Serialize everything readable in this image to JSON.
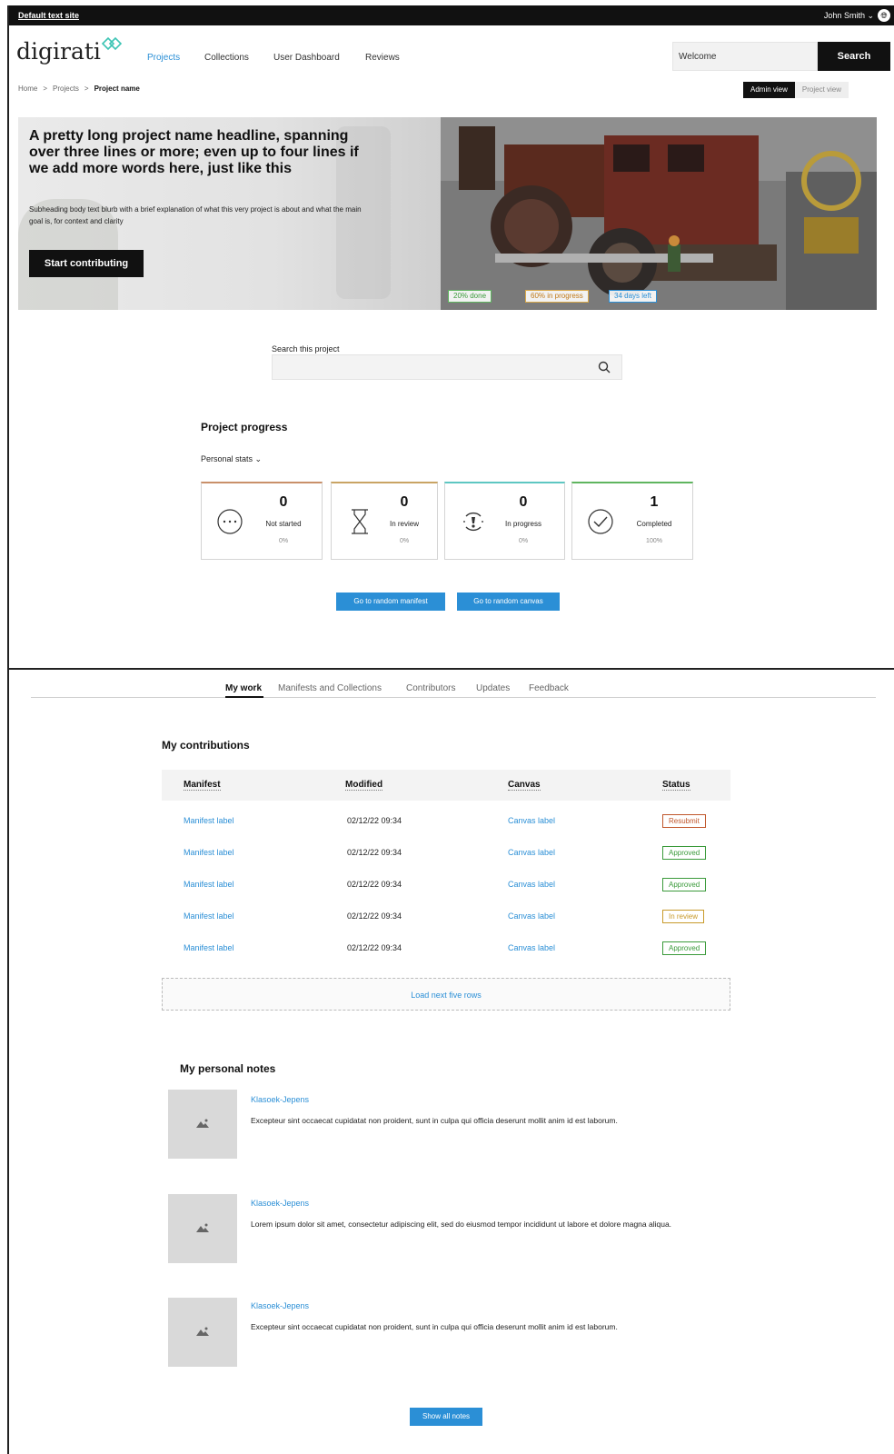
{
  "topbar": {
    "site_link": "Default text site",
    "user": "John Smith  ⌄"
  },
  "header": {
    "logo": "digirati",
    "nav": [
      "Projects",
      "Collections",
      "User Dashboard",
      "Reviews"
    ],
    "search_value": "Welcome",
    "search_button": "Search"
  },
  "breadcrumb": [
    "Home",
    "Projects",
    "Project name"
  ],
  "view_toggle": {
    "admin": "Admin view",
    "project": "Project view"
  },
  "hero": {
    "title": "A pretty long project name headline, spanning over three lines or more; even up to four lines if we add more words here, just like this",
    "subtitle": "Subheading body text blurb with a brief explanation of what this very project is about and what the main goal is, for context and clarity",
    "cta": "Start contributing",
    "badges": [
      "20% done",
      "60% in progress",
      "34 days left"
    ]
  },
  "search_project": {
    "label": "Search this project",
    "value": ""
  },
  "progress": {
    "title": "Project progress",
    "filter": "Personal stats  ⌄",
    "cards": [
      {
        "count": "0",
        "label": "Not started",
        "percent": "0%"
      },
      {
        "count": "0",
        "label": "In review",
        "percent": "0%"
      },
      {
        "count": "0",
        "label": "In progress",
        "percent": "0%"
      },
      {
        "count": "1",
        "label": "Completed",
        "percent": "100%"
      }
    ],
    "btn_manifest": "Go to random manifest",
    "btn_canvas": "Go to random canvas"
  },
  "tabs": [
    "My work",
    "Manifests and Collections",
    "Contributors",
    "Updates",
    "Feedback"
  ],
  "contributions": {
    "title": "My contributions",
    "columns": [
      "Manifest",
      "Modified",
      "Canvas",
      "Status"
    ],
    "rows": [
      {
        "manifest": "Manifest label",
        "modified": "02/12/22 09:34",
        "canvas": "Canvas label",
        "status": "Resubmit"
      },
      {
        "manifest": "Manifest label",
        "modified": "02/12/22 09:34",
        "canvas": "Canvas label",
        "status": "Approved"
      },
      {
        "manifest": "Manifest label",
        "modified": "02/12/22 09:34",
        "canvas": "Canvas label",
        "status": "Approved"
      },
      {
        "manifest": "Manifest label",
        "modified": "02/12/22 09:34",
        "canvas": "Canvas label",
        "status": "In review"
      },
      {
        "manifest": "Manifest label",
        "modified": "02/12/22 09:34",
        "canvas": "Canvas label",
        "status": "Approved"
      }
    ],
    "load_more": "Load next five rows"
  },
  "notes": {
    "title": "My personal notes",
    "items": [
      {
        "author": "Klasoek-Jepens",
        "text": "Excepteur sint occaecat cupidatat non proident, sunt in culpa qui officia deserunt mollit anim id est laborum."
      },
      {
        "author": "Klasoek-Jepens",
        "text": "Lorem ipsum dolor sit amet, consectetur adipiscing elit, sed do eiusmod tempor incididunt ut labore et dolore magna aliqua."
      },
      {
        "author": "Klasoek-Jepens",
        "text": "Excepteur sint occaecat cupidatat non proident, sunt in culpa qui officia deserunt mollit anim id est laborum."
      }
    ],
    "show_all": "Show all notes"
  },
  "colors": {
    "accent": "#2b8fd6",
    "resubmit": "#c0562b",
    "approved": "#3a9a3a",
    "in_review": "#c89a2a",
    "card_not_started": "#c9906a",
    "card_in_review": "#c9a464",
    "card_in_progress": "#5ec7c2",
    "card_completed": "#5fb55f"
  }
}
